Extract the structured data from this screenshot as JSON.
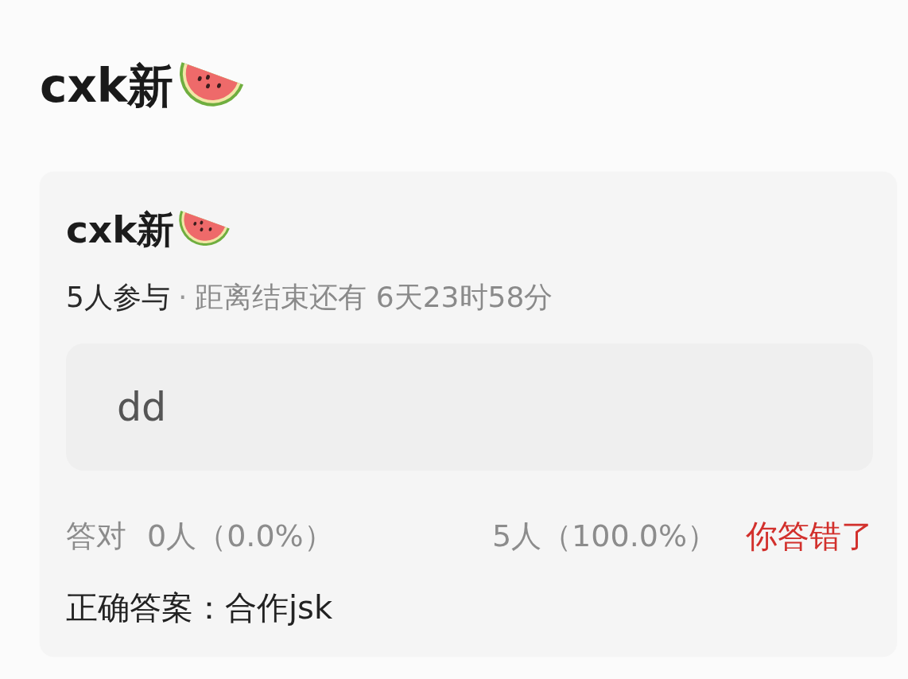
{
  "page": {
    "title": "cxk新"
  },
  "quiz": {
    "title": "cxk新",
    "participants": "5人参与",
    "separator": "·",
    "countdown": "距离结束还有 6天23时58分",
    "options": [
      {
        "text": "dd"
      }
    ],
    "stats": {
      "correct_label": "答对",
      "correct_count": "0人（0.0%）",
      "wrong_count": "5人（100.0%）"
    },
    "result": {
      "text": "你答错了",
      "correct": false
    },
    "answer": "正确答案：合作jsk"
  }
}
